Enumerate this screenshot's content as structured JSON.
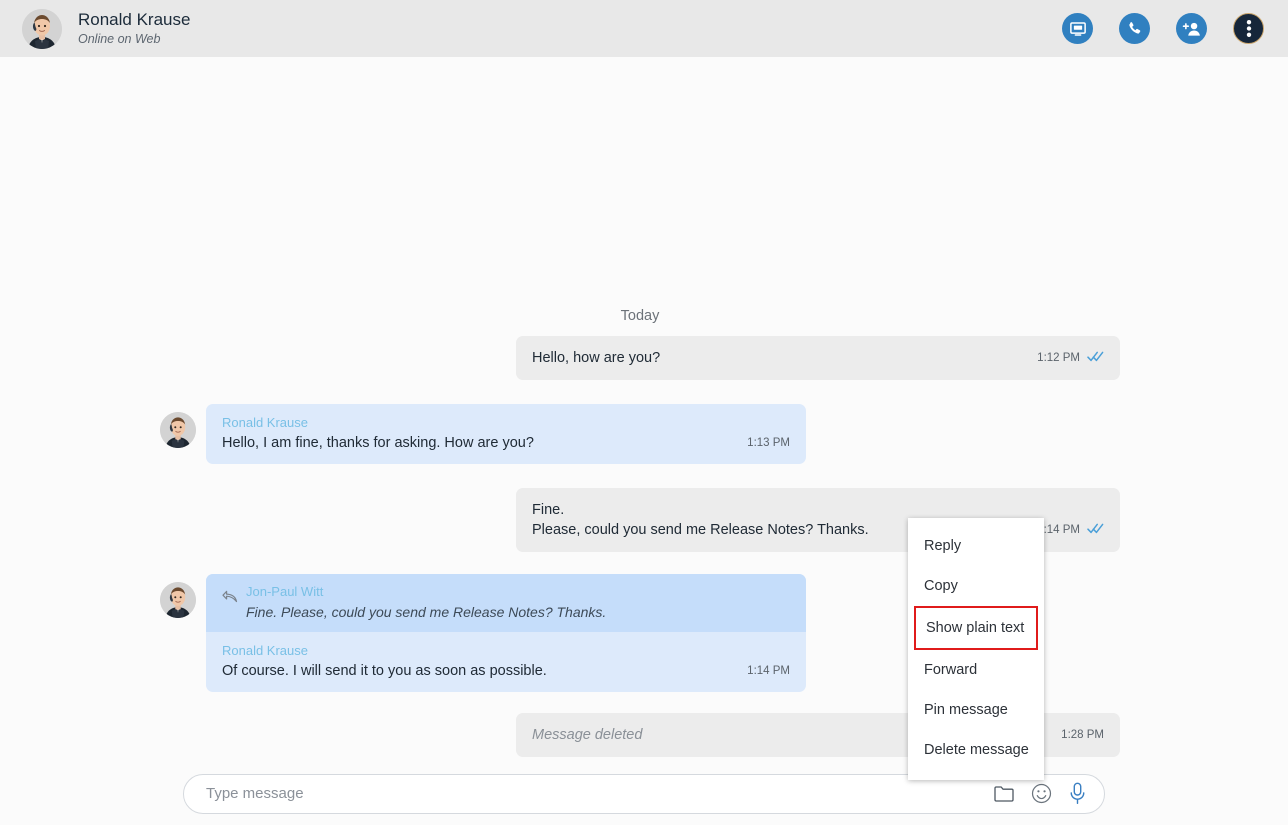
{
  "header": {
    "contact_name": "Ronald Krause",
    "status": "Online on Web",
    "avatar_icon": "contact-photo",
    "actions": [
      {
        "name": "video-call-button",
        "icon": "screen-share-icon",
        "color": "#3080c0"
      },
      {
        "name": "voice-call-button",
        "icon": "phone-icon",
        "color": "#3080c0"
      },
      {
        "name": "add-participant-button",
        "icon": "add-person-icon",
        "color": "#3080c0"
      },
      {
        "name": "more-options-button",
        "icon": "vertical-dots-icon",
        "color": "#16263a"
      }
    ]
  },
  "chat": {
    "day_separator": "Today",
    "messages": [
      {
        "direction": "outgoing",
        "lines": [
          "Hello, how are you?"
        ],
        "time": "1:12 PM",
        "receipt": "read-double-check"
      },
      {
        "direction": "incoming",
        "sender": "Ronald Krause",
        "lines": [
          "Hello, I am fine, thanks for asking. How are you?"
        ],
        "time": "1:13 PM"
      },
      {
        "direction": "outgoing",
        "lines": [
          "Fine.",
          "Please, could you send me Release Notes? Thanks."
        ],
        "time": ":14 PM",
        "receipt": "read-double-check"
      },
      {
        "direction": "incoming",
        "quote": {
          "sender": "Jon-Paul Witt",
          "text": "Fine. Please, could you send me Release Notes? Thanks."
        },
        "sender": "Ronald Krause",
        "lines": [
          "Of course. I will send it to you as soon as possible."
        ],
        "time": "1:14 PM"
      },
      {
        "direction": "outgoing",
        "lines": [
          "Message deleted"
        ],
        "deleted": true,
        "time": "1:28 PM"
      }
    ]
  },
  "context_menu": {
    "items": [
      {
        "label": "Reply",
        "selected": false
      },
      {
        "label": "Copy",
        "selected": false
      },
      {
        "label": "Show plain text",
        "selected": true
      },
      {
        "label": "Forward",
        "selected": false
      },
      {
        "label": "Pin message",
        "selected": false
      },
      {
        "label": "Delete message",
        "selected": false
      }
    ],
    "highlight_color": "#e01b1b"
  },
  "composer": {
    "placeholder": "Type message",
    "tools": [
      {
        "name": "attach-file-icon",
        "label": "folder-icon"
      },
      {
        "name": "emoji-icon",
        "label": "smiley-icon"
      },
      {
        "name": "voice-record-icon",
        "label": "microphone-icon"
      }
    ]
  },
  "colors": {
    "header_bg": "#e8e8e8",
    "body_bg": "#fbfbfb",
    "outgoing_bubble": "#ececec",
    "incoming_bubble": "#ddeafb",
    "quote_bubble": "#c5ddfa",
    "sender_name": "#79c0e6",
    "accent_blue": "#3080c0"
  }
}
